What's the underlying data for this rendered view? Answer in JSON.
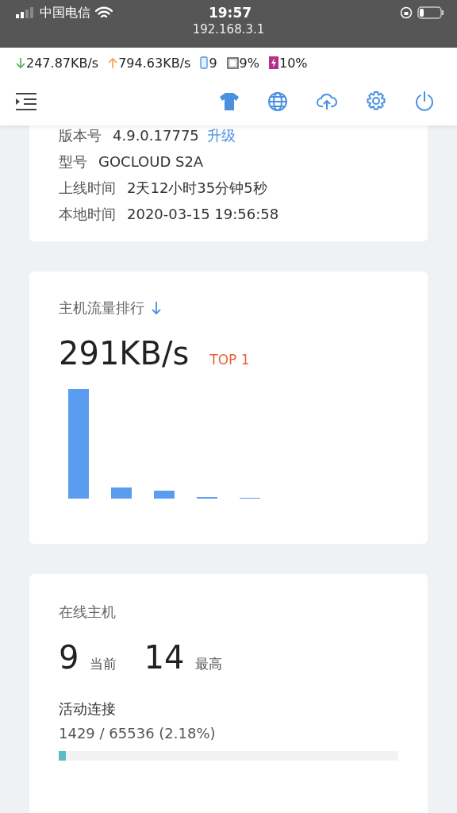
{
  "phone_status": {
    "carrier": "中国电信",
    "time": "19:57",
    "url": "192.168.3.1"
  },
  "stats": {
    "download": "247.87KB/s",
    "upload": "794.63KB/s",
    "devices": "9",
    "cpu": "9%",
    "memory": "10%"
  },
  "info": [
    {
      "label": "版本号",
      "value": "4.9.0.17775",
      "link": "升级"
    },
    {
      "label": "型号",
      "value": "GOCLOUD S2A"
    },
    {
      "label": "上线时间",
      "value": "2天12小时35分钟5秒"
    },
    {
      "label": "本地时间",
      "value": "2020-03-15 19:56:58"
    }
  ],
  "traffic": {
    "title": "主机流量排行",
    "rate": "291KB/s",
    "rank": "TOP 1"
  },
  "hosts": {
    "title": "在线主机",
    "current": "9",
    "current_label": "当前",
    "max": "14",
    "max_label": "最高",
    "conn_title": "活动连接",
    "conn_value": "1429 / 65536 (2.18%)",
    "level": 0.0218
  }
}
